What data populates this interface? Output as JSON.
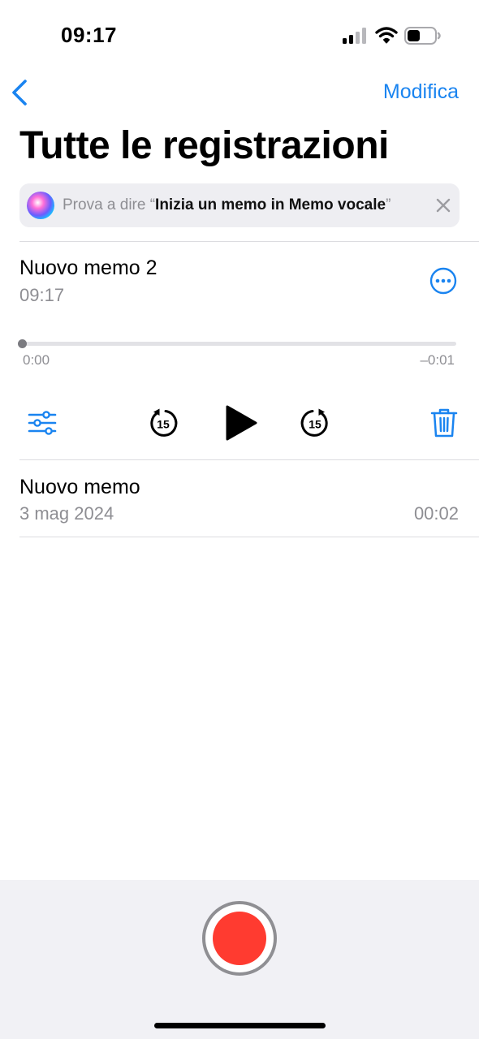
{
  "status_bar": {
    "time": "09:17",
    "icons": [
      "signal-icon",
      "wifi-icon",
      "battery-icon"
    ]
  },
  "nav": {
    "back_icon": "chevron-left-icon",
    "edit_label": "Modifica"
  },
  "page": {
    "title": "Tutte le registrazioni"
  },
  "siri_suggestion": {
    "prefix": "Prova a dire “",
    "phrase": "Inizia un memo in Memo vocale",
    "suffix": "”",
    "close_icon": "close-icon"
  },
  "recordings": [
    {
      "name": "Nuovo memo 2",
      "time": "09:17",
      "expanded": true,
      "player": {
        "elapsed": "0:00",
        "remaining": "–0:01",
        "progress": 0,
        "controls": [
          "equalizer-icon",
          "skip-back-15-icon",
          "play-icon",
          "skip-forward-15-icon",
          "trash-icon"
        ],
        "skip_seconds": "15"
      }
    },
    {
      "name": "Nuovo memo",
      "date": "3 mag 2024",
      "duration": "00:02",
      "expanded": false
    }
  ],
  "colors": {
    "accent": "#1a84f0",
    "record": "#ff3b30",
    "secondary_text": "#8e8e93",
    "bottom_bar": "#f1f1f5"
  }
}
